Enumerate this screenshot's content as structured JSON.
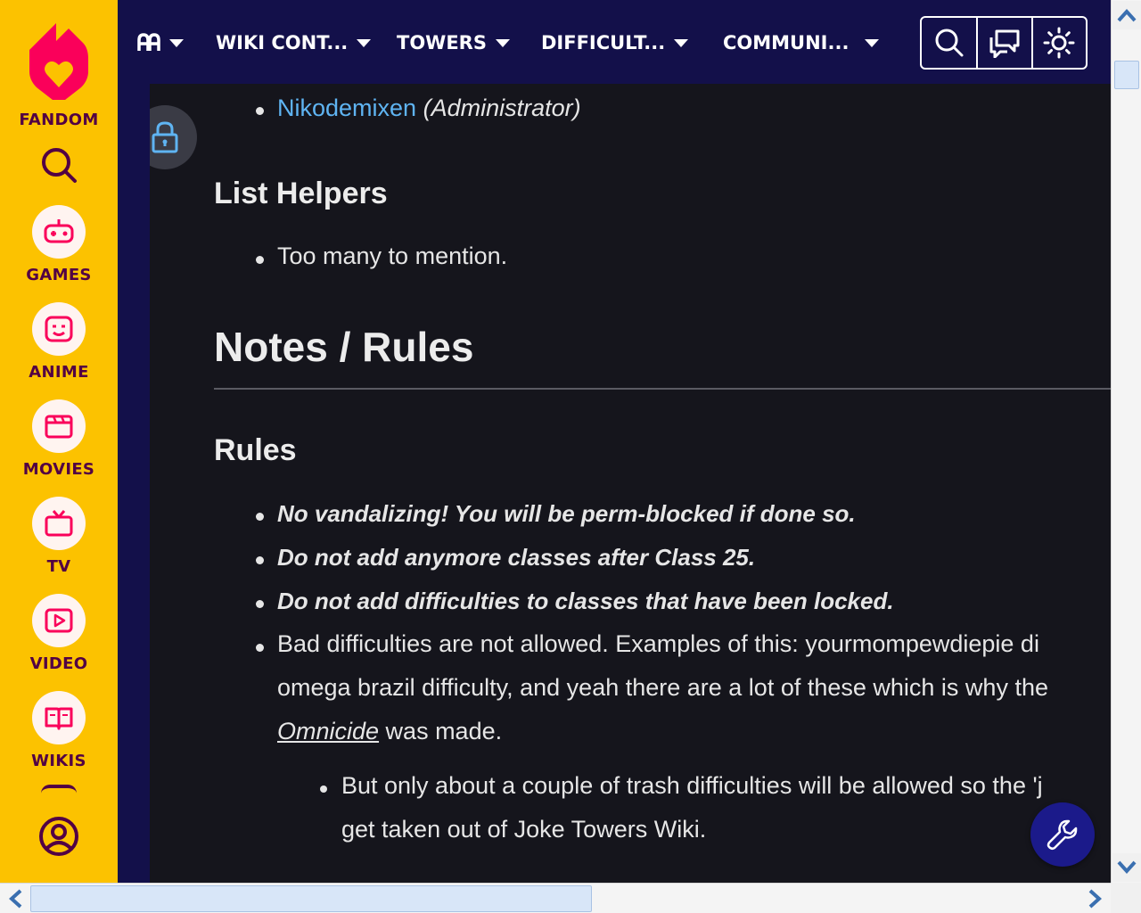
{
  "rail": {
    "brand_label": "FANDOM",
    "items": [
      {
        "label": "GAMES",
        "icon": "gamepad-icon"
      },
      {
        "label": "ANIME",
        "icon": "anime-face-icon"
      },
      {
        "label": "MOVIES",
        "icon": "clapperboard-icon"
      },
      {
        "label": "TV",
        "icon": "tv-icon"
      },
      {
        "label": "VIDEO",
        "icon": "play-icon"
      },
      {
        "label": "WIKIS",
        "icon": "book-icon"
      }
    ]
  },
  "nav": {
    "items": [
      {
        "label": ""
      },
      {
        "label": "WIKI CONT..."
      },
      {
        "label": "TOWERS"
      },
      {
        "label": "DIFFICULT..."
      },
      {
        "label": "COMMUNI..."
      }
    ]
  },
  "content": {
    "admin_link": "Nikodemixen",
    "admin_role": "(Administrator)",
    "list_helpers_heading": "List Helpers",
    "helpers_item": "Too many to mention.",
    "notes_heading": "Notes / Rules",
    "rules_heading": "Rules",
    "rules": [
      "No vandalizing! You will be perm-blocked if done so.",
      "Do not add anymore classes after Class 25.",
      "Do not add difficulties to classes that have been locked."
    ],
    "bad_diff_line1": "Bad difficulties are not allowed. Examples of this: yourmompewdiepie di",
    "bad_diff_line2": "omega brazil difficulty, and yeah there are a lot of these which is why the",
    "omnicide_link": "Omnicide",
    "was_made": " was made.",
    "sub_line1": "But only about a couple of trash difficulties will be allowed so the 'j",
    "sub_line2": "get taken out of Joke Towers Wiki."
  },
  "colors": {
    "rail_bg": "#fcc200",
    "rail_text": "#520044",
    "nav_bg": "#13104a",
    "content_bg": "#15151c",
    "link": "#5fb4f2",
    "wrench_bg": "#1b1a8a"
  }
}
